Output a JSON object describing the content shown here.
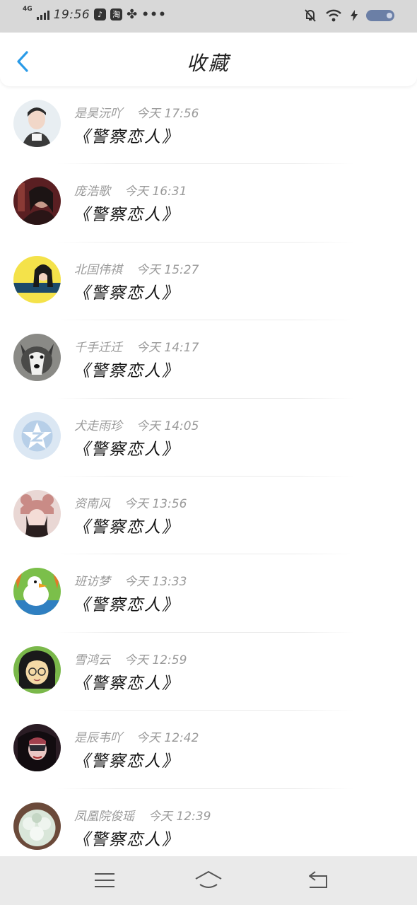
{
  "status_bar": {
    "network": "4G",
    "time": "19:56",
    "app_icons": [
      "douyin-icon",
      "taobao-icon",
      "pinwheel-icon"
    ],
    "more": "•••"
  },
  "header": {
    "title": "收藏"
  },
  "items": [
    {
      "name": "是昊沅吖",
      "time": "今天 17:56",
      "title": "《警察恋人》",
      "avatar": "avatar-1"
    },
    {
      "name": "庞浩歌",
      "time": "今天 16:31",
      "title": "《警察恋人》",
      "avatar": "avatar-2"
    },
    {
      "name": "北国伟祺",
      "time": "今天 15:27",
      "title": "《警察恋人》",
      "avatar": "avatar-3"
    },
    {
      "name": "千手迁迁",
      "time": "今天 14:17",
      "title": "《警察恋人》",
      "avatar": "avatar-4"
    },
    {
      "name": "犬走雨珍",
      "time": "今天 14:05",
      "title": "《警察恋人》",
      "avatar": "avatar-5"
    },
    {
      "name": "资南风",
      "time": "今天 13:56",
      "title": "《警察恋人》",
      "avatar": "avatar-6"
    },
    {
      "name": "班访梦",
      "time": "今天 13:33",
      "title": "《警察恋人》",
      "avatar": "avatar-7"
    },
    {
      "name": "雪鸿云",
      "time": "今天 12:59",
      "title": "《警察恋人》",
      "avatar": "avatar-8"
    },
    {
      "name": "是辰韦吖",
      "time": "今天 12:42",
      "title": "《警察恋人》",
      "avatar": "avatar-9"
    },
    {
      "name": "凤凰院俊瑶",
      "time": "今天 12:39",
      "title": "《警察恋人》",
      "avatar": "avatar-10"
    }
  ],
  "colors": {
    "accent": "#2a9be8",
    "status_bg": "#d8d8d8",
    "nav_bg": "#eaeaea"
  },
  "nav": [
    "menu-icon",
    "home-icon",
    "back-icon"
  ]
}
